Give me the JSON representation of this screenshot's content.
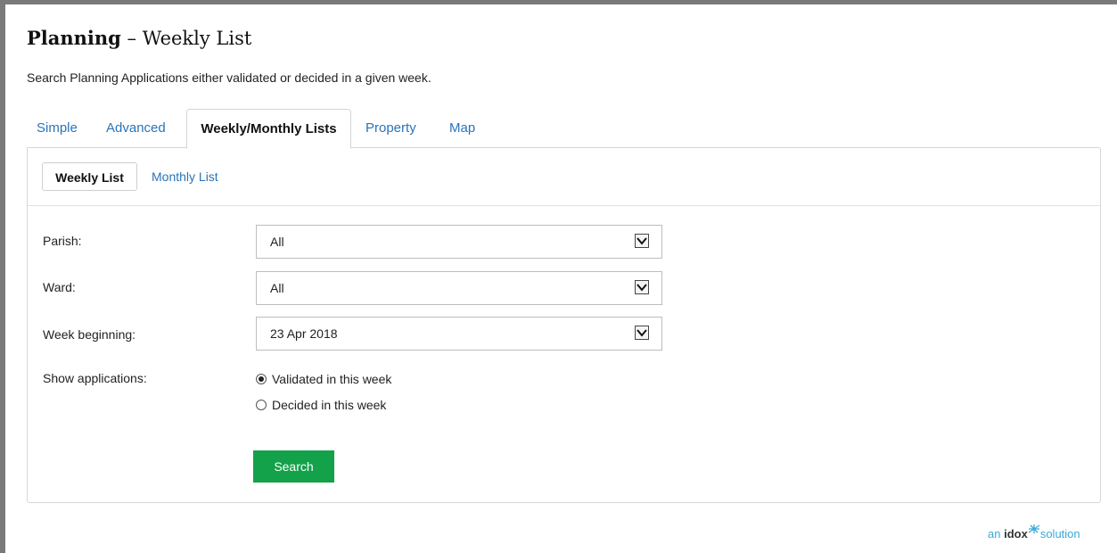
{
  "page": {
    "title_bold": "Planning",
    "title_rest": "– Weekly List",
    "intro": "Search Planning Applications either validated or decided in a given week."
  },
  "tabs": [
    {
      "label": "Simple",
      "active": false
    },
    {
      "label": "Advanced",
      "active": false
    },
    {
      "label": "Weekly/Monthly Lists",
      "active": true
    },
    {
      "label": "Property",
      "active": false
    },
    {
      "label": "Map",
      "active": false
    }
  ],
  "subtabs": [
    {
      "label": "Weekly List",
      "active": true
    },
    {
      "label": "Monthly List",
      "active": false
    }
  ],
  "form": {
    "parish": {
      "label": "Parish:",
      "value": "All"
    },
    "ward": {
      "label": "Ward:",
      "value": "All"
    },
    "week": {
      "label": "Week beginning:",
      "value": "23 Apr 2018"
    },
    "show": {
      "label": "Show applications:",
      "options": [
        {
          "label": "Validated in this week",
          "checked": true
        },
        {
          "label": "Decided in this week",
          "checked": false
        }
      ]
    },
    "search_label": "Search"
  },
  "footer": {
    "prefix": "an",
    "brand": "idox",
    "suffix": "solution"
  },
  "icons": {
    "dropdown": "chevron-down-icon",
    "logo_mark": "idox-star-icon"
  },
  "colors": {
    "link": "#2a73b8",
    "button": "#13a14a",
    "logo": "#3aa9d8"
  }
}
